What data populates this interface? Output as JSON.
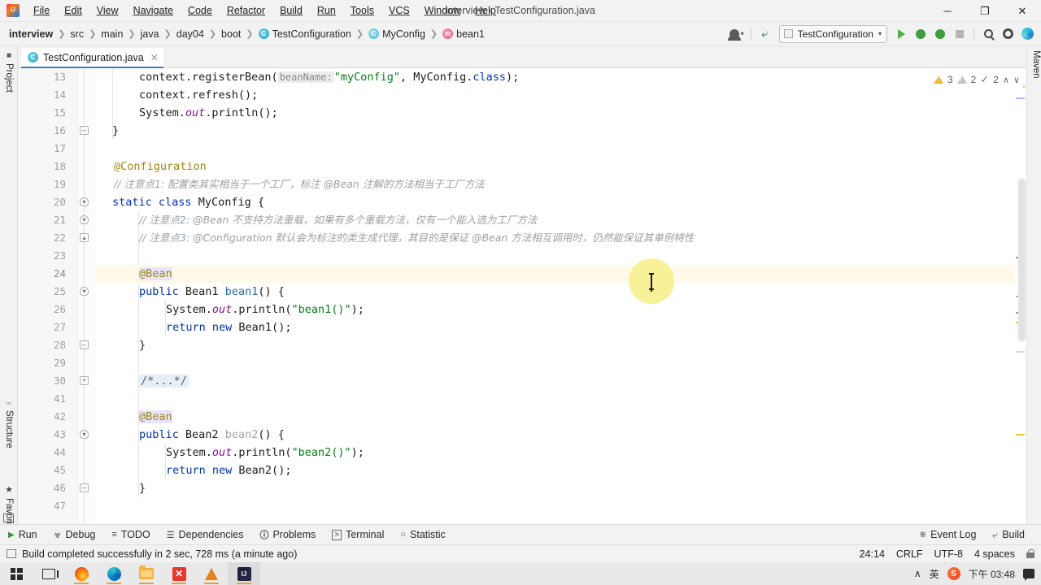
{
  "window": {
    "title": "interview - TestConfiguration.java",
    "minimize": "─",
    "maximize": "❐",
    "close": "✕"
  },
  "menu": [
    {
      "label": "File"
    },
    {
      "label": "Edit"
    },
    {
      "label": "View"
    },
    {
      "label": "Navigate"
    },
    {
      "label": "Code"
    },
    {
      "label": "Refactor"
    },
    {
      "label": "Build"
    },
    {
      "label": "Run"
    },
    {
      "label": "Tools"
    },
    {
      "label": "VCS"
    },
    {
      "label": "Window"
    },
    {
      "label": "Help"
    }
  ],
  "breadcrumbs": [
    {
      "label": "interview",
      "icon": null
    },
    {
      "label": "src",
      "icon": null
    },
    {
      "label": "main",
      "icon": null
    },
    {
      "label": "java",
      "icon": null
    },
    {
      "label": "day04",
      "icon": null
    },
    {
      "label": "boot",
      "icon": null
    },
    {
      "label": "TestConfiguration",
      "icon": "class-icon"
    },
    {
      "label": "MyConfig",
      "icon": "class-icon"
    },
    {
      "label": "bean1",
      "icon": "method-icon"
    }
  ],
  "toolbar": {
    "run_configuration": "TestConfiguration",
    "dropdown_caret": "▾",
    "run_label": "Run",
    "debug_label": "Debug",
    "coverage_label": "Run with Coverage",
    "stop_label": "Stop",
    "search_label": "Search Everywhere",
    "settings_label": "Settings",
    "updates_label": "Updates"
  },
  "left_strip": [
    {
      "label": "Project",
      "icon": "folder-icon"
    },
    {
      "label": "Structure",
      "icon": "structure-icon"
    },
    {
      "label": "Favorites",
      "icon": "star-icon"
    }
  ],
  "right_strip": [
    {
      "label": "Maven",
      "icon": "maven-icon"
    }
  ],
  "editor_tab": {
    "label": "TestConfiguration.java",
    "icon": "java-class-icon",
    "close": "✕"
  },
  "inspections": {
    "warnings": "3",
    "weak_warnings": "2",
    "typos": "2",
    "up": "∧",
    "down": "∨"
  },
  "code": {
    "lines": [
      {
        "num": "13",
        "indent": 0
      },
      {
        "num": "14",
        "indent": 0
      },
      {
        "num": "15",
        "indent": 0
      },
      {
        "num": "16",
        "indent": 0
      },
      {
        "num": "17",
        "indent": 0
      },
      {
        "num": "18",
        "indent": 0
      },
      {
        "num": "19",
        "indent": 0
      },
      {
        "num": "20",
        "indent": 0
      },
      {
        "num": "21",
        "indent": 0
      },
      {
        "num": "22",
        "indent": 0
      },
      {
        "num": "23",
        "indent": 0
      },
      {
        "num": "24",
        "indent": 0
      },
      {
        "num": "25",
        "indent": 0
      },
      {
        "num": "26",
        "indent": 0
      },
      {
        "num": "27",
        "indent": 0
      },
      {
        "num": "28",
        "indent": 0
      },
      {
        "num": "29",
        "indent": 0
      },
      {
        "num": "30",
        "indent": 0
      },
      {
        "num": "41",
        "indent": 0
      },
      {
        "num": "42",
        "indent": 0
      },
      {
        "num": "43",
        "indent": 0
      },
      {
        "num": "44",
        "indent": 0
      },
      {
        "num": "45",
        "indent": 0
      },
      {
        "num": "46",
        "indent": 0
      },
      {
        "num": "47",
        "indent": 0
      }
    ],
    "text": {
      "l13_a": "context.registerBean(",
      "l13_hint": "beanName:",
      "l13_b": "\"myConfig\"",
      "l13_c": ", MyConfig.",
      "l13_kw": "class",
      "l13_d": ");",
      "l14": "context.refresh();",
      "l15_a": "System.",
      "l15_out": "out",
      "l15_b": ".println();",
      "l16": "}",
      "l18": "@Configuration",
      "l19": "// 注意点1: 配置类其实相当于一个工厂，标注 @Bean 注解的方法相当于工厂方法",
      "l20_kw": "static class",
      "l20_name": "MyConfig",
      "l20_brace": "{",
      "l21": "// 注意点2: @Bean 不支持方法重载，如果有多个重载方法，仅有一个能入选为工厂方法",
      "l22": "// 注意点3: @Configuration 默认会为标注的类生成代理，其目的是保证 @Bean 方法相互调用时，仍然能保证其单例特性",
      "l24": "@Bean",
      "l25_kw": "public",
      "l25_type": "Bean1",
      "l25_name": "bean1",
      "l25_rest": "() {",
      "l26_a": "System.",
      "l26_out": "out",
      "l26_b": ".println(",
      "l26_str": "\"bean1()\"",
      "l26_c": ");",
      "l27_kw": "return new",
      "l27_rest": "Bean1();",
      "l28": "}",
      "l30_fold": "/*...*/",
      "l42": "@Bean",
      "l43_kw": "public",
      "l43_type": "Bean2",
      "l43_name": "bean2",
      "l43_rest": "() {",
      "l44_a": "System.",
      "l44_out": "out",
      "l44_b": ".println(",
      "l44_str": "\"bean2()\"",
      "l44_c": ");",
      "l45_kw": "return new",
      "l45_rest": "Bean2();",
      "l46": "}"
    }
  },
  "bottom_bar": {
    "items": [
      {
        "label": "Run",
        "icon": "play-icon"
      },
      {
        "label": "Debug",
        "icon": "bug-icon"
      },
      {
        "label": "TODO",
        "icon": "list-icon"
      },
      {
        "label": "Dependencies",
        "icon": "layers-icon"
      },
      {
        "label": "Problems",
        "icon": "info-icon"
      },
      {
        "label": "Terminal",
        "icon": "terminal-icon"
      },
      {
        "label": "Statistic",
        "icon": "clock-icon"
      }
    ],
    "right_items": [
      {
        "label": "Event Log",
        "icon": "balloon-icon"
      },
      {
        "label": "Build",
        "icon": "hammer-icon"
      }
    ]
  },
  "status_bar": {
    "message": "Build completed successfully in 2 sec, 728 ms (a minute ago)",
    "caret_position": "24:14",
    "line_separator": "CRLF",
    "encoding": "UTF-8",
    "indent": "4 spaces",
    "lock": "lock-icon"
  },
  "taskbar": {
    "items": [
      {
        "name": "start-button",
        "icon": "windows-icon"
      },
      {
        "name": "task-view-button",
        "icon": "task-view-icon"
      },
      {
        "name": "firefox",
        "icon": "firefox-icon"
      },
      {
        "name": "edge",
        "icon": "edge-icon"
      },
      {
        "name": "file-explorer",
        "icon": "folder-icon"
      },
      {
        "name": "xmind",
        "icon": "xmind-icon"
      },
      {
        "name": "vlc",
        "icon": "vlc-icon"
      },
      {
        "name": "intellij-idea",
        "icon": "intellij-icon"
      }
    ],
    "tray": {
      "overflow": "∧",
      "ime": "英",
      "sogou": "S",
      "clock": "下午 03:48",
      "notifications": "notification-icon"
    }
  },
  "colors": {
    "accent": "#3c79c8",
    "keyword": "#0033b3",
    "string": "#067d17",
    "annotation": "#9e880d",
    "comment": "#8c8c8c",
    "highlight_row": "#fffae8",
    "click_highlight": "#f7ef86"
  }
}
